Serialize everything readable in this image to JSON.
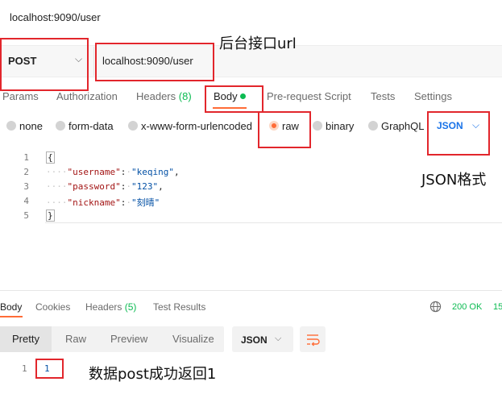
{
  "request": {
    "title": "localhost:9090/user",
    "method": "POST",
    "url": "localhost:9090/user"
  },
  "request_tabs": [
    {
      "label": "Params"
    },
    {
      "label": "Authorization"
    },
    {
      "label": "Headers",
      "count": "(8)"
    },
    {
      "label": "Body",
      "active": true
    },
    {
      "label": "Pre-request Script"
    },
    {
      "label": "Tests"
    },
    {
      "label": "Settings"
    }
  ],
  "body_types": [
    {
      "label": "none"
    },
    {
      "label": "form-data"
    },
    {
      "label": "x-www-form-urlencoded"
    },
    {
      "label": "raw",
      "selected": true
    },
    {
      "label": "binary"
    },
    {
      "label": "GraphQL"
    }
  ],
  "body_format": "JSON",
  "editor": {
    "line_numbers": [
      "1",
      "2",
      "3",
      "4",
      "5"
    ],
    "open_brace": "{",
    "close_brace": "}",
    "fields": [
      {
        "key": "\"username\"",
        "value": "\"keqing\"",
        "trail": ","
      },
      {
        "key": "\"password\"",
        "value": "\"123\"",
        "trail": ","
      },
      {
        "key": "\"nickname\"",
        "value": "\"刻晴\"",
        "trail": ""
      }
    ]
  },
  "response_tabs": [
    {
      "label": "Body",
      "active": true
    },
    {
      "label": "Cookies"
    },
    {
      "label": "Headers",
      "count": "(5)"
    },
    {
      "label": "Test Results"
    }
  ],
  "response_status": "200 OK",
  "response_status_extra": "15",
  "view_tabs": [
    {
      "label": "Pretty",
      "active": true
    },
    {
      "label": "Raw"
    },
    {
      "label": "Preview"
    },
    {
      "label": "Visualize"
    }
  ],
  "response_format": "JSON",
  "response_body": {
    "line": "1",
    "value": "1"
  },
  "annotations": {
    "url_note": "后台接口url",
    "json_note": "JSON格式",
    "result_note": "数据post成功返回1"
  },
  "colors": {
    "accent": "#ff6c37",
    "success": "#0cbb52",
    "annotation_box": "#e2262c",
    "link_blue": "#1a73e8"
  }
}
